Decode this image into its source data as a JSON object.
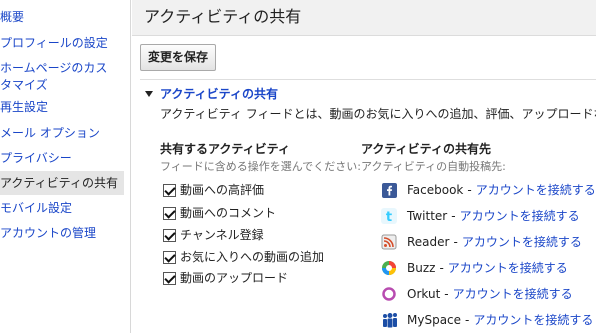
{
  "sidebar": {
    "items": [
      {
        "label": "概要"
      },
      {
        "label": "プロフィールの設定"
      },
      {
        "label": "ホームページのカスタマイズ"
      },
      {
        "label": "再生設定"
      },
      {
        "label": "メール オプション"
      },
      {
        "label": "プライバシー"
      },
      {
        "label": "アクティビティの共有"
      },
      {
        "label": "モバイル設定"
      },
      {
        "label": "アカウントの管理"
      }
    ]
  },
  "header": {
    "title": "アクティビティの共有"
  },
  "toolbar": {
    "save_label": "変更を保存"
  },
  "section": {
    "title": "アクティビティの共有",
    "description": "アクティビティ フィードとは、動画のお気に入りへの追加、評価、アップロードなど、YouTube"
  },
  "activities": {
    "heading": "共有するアクティビティ",
    "subheading": "フィードに含める操作を選んでください:",
    "items": [
      {
        "label": "動画への高評価",
        "checked": true
      },
      {
        "label": "動画へのコメント",
        "checked": true
      },
      {
        "label": "チャンネル登録",
        "checked": true
      },
      {
        "label": "お気に入りへの動画の追加",
        "checked": true
      },
      {
        "label": "動画のアップロード",
        "checked": true
      }
    ]
  },
  "destinations": {
    "heading": "アクティビティの共有先",
    "subheading": "アクティビティの自動投稿先:",
    "separator": "-",
    "services": [
      {
        "name": "Facebook",
        "link": "アカウントを接続する",
        "icon": "facebook-icon",
        "color": "#3b5998"
      },
      {
        "name": "Twitter",
        "link": "アカウントを接続する",
        "icon": "twitter-icon",
        "color": "#33ccff"
      },
      {
        "name": "Reader",
        "link": "アカウントを接続する",
        "icon": "reader-icon",
        "color": "#d54e2b"
      },
      {
        "name": "Buzz",
        "link": "アカウントを接続する",
        "icon": "buzz-icon",
        "color": "#4caf50"
      },
      {
        "name": "Orkut",
        "link": "アカウントを接続する",
        "icon": "orkut-icon",
        "color": "#b84cb0"
      },
      {
        "name": "MySpace",
        "link": "アカウントを接続する",
        "icon": "myspace-icon",
        "color": "#1c4ea6"
      }
    ]
  },
  "colors": {
    "link": "#1a46c8",
    "active_bg": "#e5e5e5",
    "header_bg": "#f1f1f1"
  }
}
